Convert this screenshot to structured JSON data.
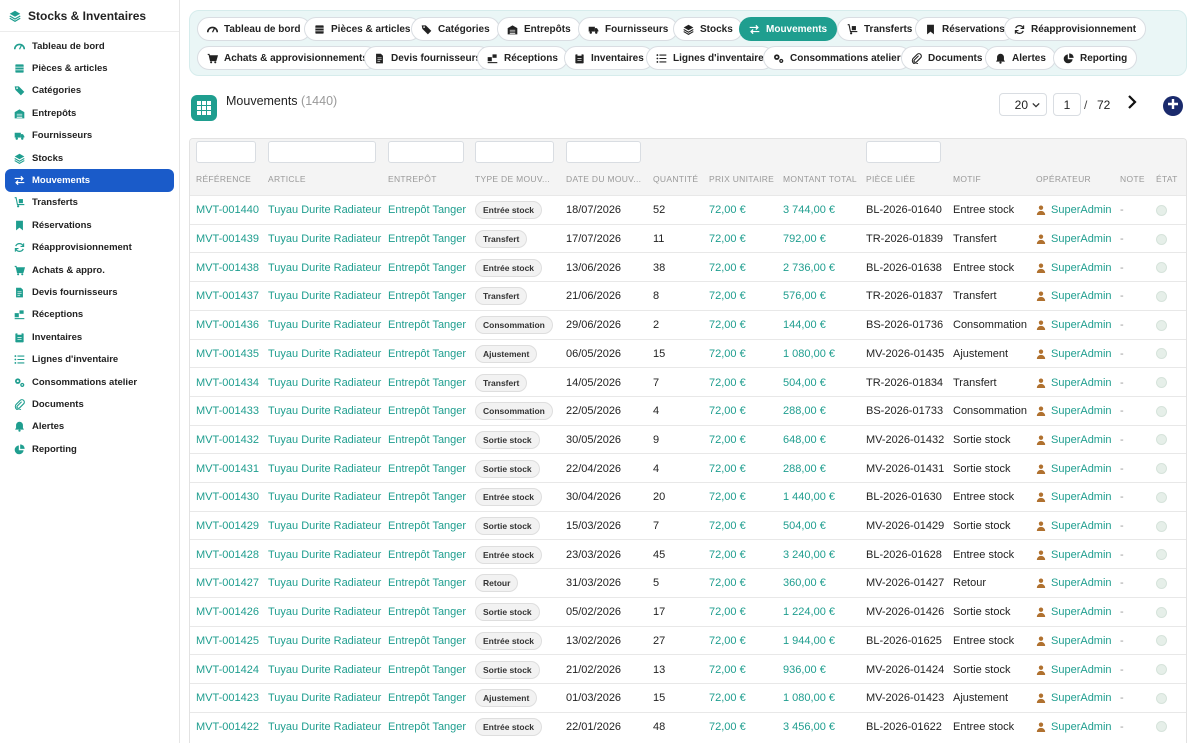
{
  "sidebar": {
    "title": "Stocks & Inventaires",
    "items": [
      {
        "label": "Tableau de bord",
        "icon": "gauge-icon"
      },
      {
        "label": "Pièces & articles",
        "icon": "boxes-icon"
      },
      {
        "label": "Catégories",
        "icon": "tags-icon"
      },
      {
        "label": "Entrepôts",
        "icon": "warehouse-icon"
      },
      {
        "label": "Fournisseurs",
        "icon": "truck-icon"
      },
      {
        "label": "Stocks",
        "icon": "layers-icon"
      },
      {
        "label": "Mouvements",
        "icon": "exchange-icon",
        "active": true
      },
      {
        "label": "Transferts",
        "icon": "dolly-icon"
      },
      {
        "label": "Réservations",
        "icon": "bookmark-icon"
      },
      {
        "label": "Réapprovisionnement",
        "icon": "refresh-icon"
      },
      {
        "label": "Achats & appro.",
        "icon": "cart-icon"
      },
      {
        "label": "Devis fournisseurs",
        "icon": "file-icon"
      },
      {
        "label": "Réceptions",
        "icon": "receive-icon"
      },
      {
        "label": "Inventaires",
        "icon": "clipboard-icon"
      },
      {
        "label": "Lignes d'inventaire",
        "icon": "list-icon"
      },
      {
        "label": "Consommations atelier",
        "icon": "cogs-icon"
      },
      {
        "label": "Documents",
        "icon": "paperclip-icon"
      },
      {
        "label": "Alertes",
        "icon": "bell-icon"
      },
      {
        "label": "Reporting",
        "icon": "pie-chart-icon"
      }
    ]
  },
  "tabs": {
    "row1": [
      {
        "label": "Tableau de bord",
        "icon": "gauge-icon"
      },
      {
        "label": "Pièces & articles",
        "icon": "boxes-icon"
      },
      {
        "label": "Catégories",
        "icon": "tags-icon"
      },
      {
        "label": "Entrepôts",
        "icon": "warehouse-icon"
      },
      {
        "label": "Fournisseurs",
        "icon": "truck-icon"
      },
      {
        "label": "Stocks",
        "icon": "layers-icon"
      },
      {
        "label": "Mouvements",
        "icon": "exchange-icon",
        "active": true
      },
      {
        "label": "Transferts",
        "icon": "dolly-icon"
      },
      {
        "label": "Réservations",
        "icon": "bookmark-icon"
      },
      {
        "label": "Réapprovisionnement",
        "icon": "refresh-icon"
      }
    ],
    "row2": [
      {
        "label": "Achats & approvisionnements",
        "icon": "cart-icon"
      },
      {
        "label": "Devis fournisseurs",
        "icon": "file-icon"
      },
      {
        "label": "Réceptions",
        "icon": "receive-icon"
      },
      {
        "label": "Inventaires",
        "icon": "clipboard-icon"
      },
      {
        "label": "Lignes d'inventaire",
        "icon": "list-icon"
      },
      {
        "label": "Consommations atelier",
        "icon": "cogs-icon"
      },
      {
        "label": "Documents",
        "icon": "paperclip-icon"
      },
      {
        "label": "Alertes",
        "icon": "bell-icon"
      },
      {
        "label": "Reporting",
        "icon": "pie-chart-icon"
      }
    ]
  },
  "header": {
    "title": "Mouvements",
    "count": "(1440)"
  },
  "pagination": {
    "per_page": "20",
    "page": "1",
    "separator": "/",
    "total_pages": "72"
  },
  "colors": {
    "accent": "#1f9e8f",
    "active_nav": "#1a5bc9",
    "add_button": "#1a2a6c"
  },
  "table": {
    "columns": [
      "RÉFÉRENCE",
      "ARTICLE",
      "ENTREPÔT",
      "TYPE DE MOUV...",
      "DATE DU MOUV...",
      "QUANTITÉ",
      "PRIX UNITAIRE",
      "MONTANT TOTAL",
      "PIÈCE LIÉE",
      "MOTIF",
      "OPÉRATEUR",
      "NOTE",
      "ÉTAT"
    ],
    "rows": [
      {
        "ref": "MVT-001440",
        "article": "Tuyau Durite Radiateur",
        "depot": "Entrepôt Tanger",
        "type": "Entrée stock",
        "date": "18/07/2026",
        "qty": "52",
        "unit": "72,00 €",
        "total": "3 744,00 €",
        "piece": "BL-2026-01640",
        "motif": "Entree stock",
        "op": "SuperAdmin",
        "note": "-"
      },
      {
        "ref": "MVT-001439",
        "article": "Tuyau Durite Radiateur",
        "depot": "Entrepôt Tanger",
        "type": "Transfert",
        "date": "17/07/2026",
        "qty": "11",
        "unit": "72,00 €",
        "total": "792,00 €",
        "piece": "TR-2026-01839",
        "motif": "Transfert",
        "op": "SuperAdmin",
        "note": "-"
      },
      {
        "ref": "MVT-001438",
        "article": "Tuyau Durite Radiateur",
        "depot": "Entrepôt Tanger",
        "type": "Entrée stock",
        "date": "13/06/2026",
        "qty": "38",
        "unit": "72,00 €",
        "total": "2 736,00 €",
        "piece": "BL-2026-01638",
        "motif": "Entree stock",
        "op": "SuperAdmin",
        "note": "-"
      },
      {
        "ref": "MVT-001437",
        "article": "Tuyau Durite Radiateur",
        "depot": "Entrepôt Tanger",
        "type": "Transfert",
        "date": "21/06/2026",
        "qty": "8",
        "unit": "72,00 €",
        "total": "576,00 €",
        "piece": "TR-2026-01837",
        "motif": "Transfert",
        "op": "SuperAdmin",
        "note": "-"
      },
      {
        "ref": "MVT-001436",
        "article": "Tuyau Durite Radiateur",
        "depot": "Entrepôt Tanger",
        "type": "Consommation",
        "date": "29/06/2026",
        "qty": "2",
        "unit": "72,00 €",
        "total": "144,00 €",
        "piece": "BS-2026-01736",
        "motif": "Consommation",
        "op": "SuperAdmin",
        "note": "-"
      },
      {
        "ref": "MVT-001435",
        "article": "Tuyau Durite Radiateur",
        "depot": "Entrepôt Tanger",
        "type": "Ajustement",
        "date": "06/05/2026",
        "qty": "15",
        "unit": "72,00 €",
        "total": "1 080,00 €",
        "piece": "MV-2026-01435",
        "motif": "Ajustement",
        "op": "SuperAdmin",
        "note": "-"
      },
      {
        "ref": "MVT-001434",
        "article": "Tuyau Durite Radiateur",
        "depot": "Entrepôt Tanger",
        "type": "Transfert",
        "date": "14/05/2026",
        "qty": "7",
        "unit": "72,00 €",
        "total": "504,00 €",
        "piece": "TR-2026-01834",
        "motif": "Transfert",
        "op": "SuperAdmin",
        "note": "-"
      },
      {
        "ref": "MVT-001433",
        "article": "Tuyau Durite Radiateur",
        "depot": "Entrepôt Tanger",
        "type": "Consommation",
        "date": "22/05/2026",
        "qty": "4",
        "unit": "72,00 €",
        "total": "288,00 €",
        "piece": "BS-2026-01733",
        "motif": "Consommation",
        "op": "SuperAdmin",
        "note": "-"
      },
      {
        "ref": "MVT-001432",
        "article": "Tuyau Durite Radiateur",
        "depot": "Entrepôt Tanger",
        "type": "Sortie stock",
        "date": "30/05/2026",
        "qty": "9",
        "unit": "72,00 €",
        "total": "648,00 €",
        "piece": "MV-2026-01432",
        "motif": "Sortie stock",
        "op": "SuperAdmin",
        "note": "-"
      },
      {
        "ref": "MVT-001431",
        "article": "Tuyau Durite Radiateur",
        "depot": "Entrepôt Tanger",
        "type": "Sortie stock",
        "date": "22/04/2026",
        "qty": "4",
        "unit": "72,00 €",
        "total": "288,00 €",
        "piece": "MV-2026-01431",
        "motif": "Sortie stock",
        "op": "SuperAdmin",
        "note": "-"
      },
      {
        "ref": "MVT-001430",
        "article": "Tuyau Durite Radiateur",
        "depot": "Entrepôt Tanger",
        "type": "Entrée stock",
        "date": "30/04/2026",
        "qty": "20",
        "unit": "72,00 €",
        "total": "1 440,00 €",
        "piece": "BL-2026-01630",
        "motif": "Entree stock",
        "op": "SuperAdmin",
        "note": "-"
      },
      {
        "ref": "MVT-001429",
        "article": "Tuyau Durite Radiateur",
        "depot": "Entrepôt Tanger",
        "type": "Sortie stock",
        "date": "15/03/2026",
        "qty": "7",
        "unit": "72,00 €",
        "total": "504,00 €",
        "piece": "MV-2026-01429",
        "motif": "Sortie stock",
        "op": "SuperAdmin",
        "note": "-"
      },
      {
        "ref": "MVT-001428",
        "article": "Tuyau Durite Radiateur",
        "depot": "Entrepôt Tanger",
        "type": "Entrée stock",
        "date": "23/03/2026",
        "qty": "45",
        "unit": "72,00 €",
        "total": "3 240,00 €",
        "piece": "BL-2026-01628",
        "motif": "Entree stock",
        "op": "SuperAdmin",
        "note": "-"
      },
      {
        "ref": "MVT-001427",
        "article": "Tuyau Durite Radiateur",
        "depot": "Entrepôt Tanger",
        "type": "Retour",
        "date": "31/03/2026",
        "qty": "5",
        "unit": "72,00 €",
        "total": "360,00 €",
        "piece": "MV-2026-01427",
        "motif": "Retour",
        "op": "SuperAdmin",
        "note": "-"
      },
      {
        "ref": "MVT-001426",
        "article": "Tuyau Durite Radiateur",
        "depot": "Entrepôt Tanger",
        "type": "Sortie stock",
        "date": "05/02/2026",
        "qty": "17",
        "unit": "72,00 €",
        "total": "1 224,00 €",
        "piece": "MV-2026-01426",
        "motif": "Sortie stock",
        "op": "SuperAdmin",
        "note": "-"
      },
      {
        "ref": "MVT-001425",
        "article": "Tuyau Durite Radiateur",
        "depot": "Entrepôt Tanger",
        "type": "Entrée stock",
        "date": "13/02/2026",
        "qty": "27",
        "unit": "72,00 €",
        "total": "1 944,00 €",
        "piece": "BL-2026-01625",
        "motif": "Entree stock",
        "op": "SuperAdmin",
        "note": "-"
      },
      {
        "ref": "MVT-001424",
        "article": "Tuyau Durite Radiateur",
        "depot": "Entrepôt Tanger",
        "type": "Sortie stock",
        "date": "21/02/2026",
        "qty": "13",
        "unit": "72,00 €",
        "total": "936,00 €",
        "piece": "MV-2026-01424",
        "motif": "Sortie stock",
        "op": "SuperAdmin",
        "note": "-"
      },
      {
        "ref": "MVT-001423",
        "article": "Tuyau Durite Radiateur",
        "depot": "Entrepôt Tanger",
        "type": "Ajustement",
        "date": "01/03/2026",
        "qty": "15",
        "unit": "72,00 €",
        "total": "1 080,00 €",
        "piece": "MV-2026-01423",
        "motif": "Ajustement",
        "op": "SuperAdmin",
        "note": "-"
      },
      {
        "ref": "MVT-001422",
        "article": "Tuyau Durite Radiateur",
        "depot": "Entrepôt Tanger",
        "type": "Entrée stock",
        "date": "22/01/2026",
        "qty": "48",
        "unit": "72,00 €",
        "total": "3 456,00 €",
        "piece": "BL-2026-01622",
        "motif": "Entree stock",
        "op": "SuperAdmin",
        "note": "-"
      }
    ]
  }
}
